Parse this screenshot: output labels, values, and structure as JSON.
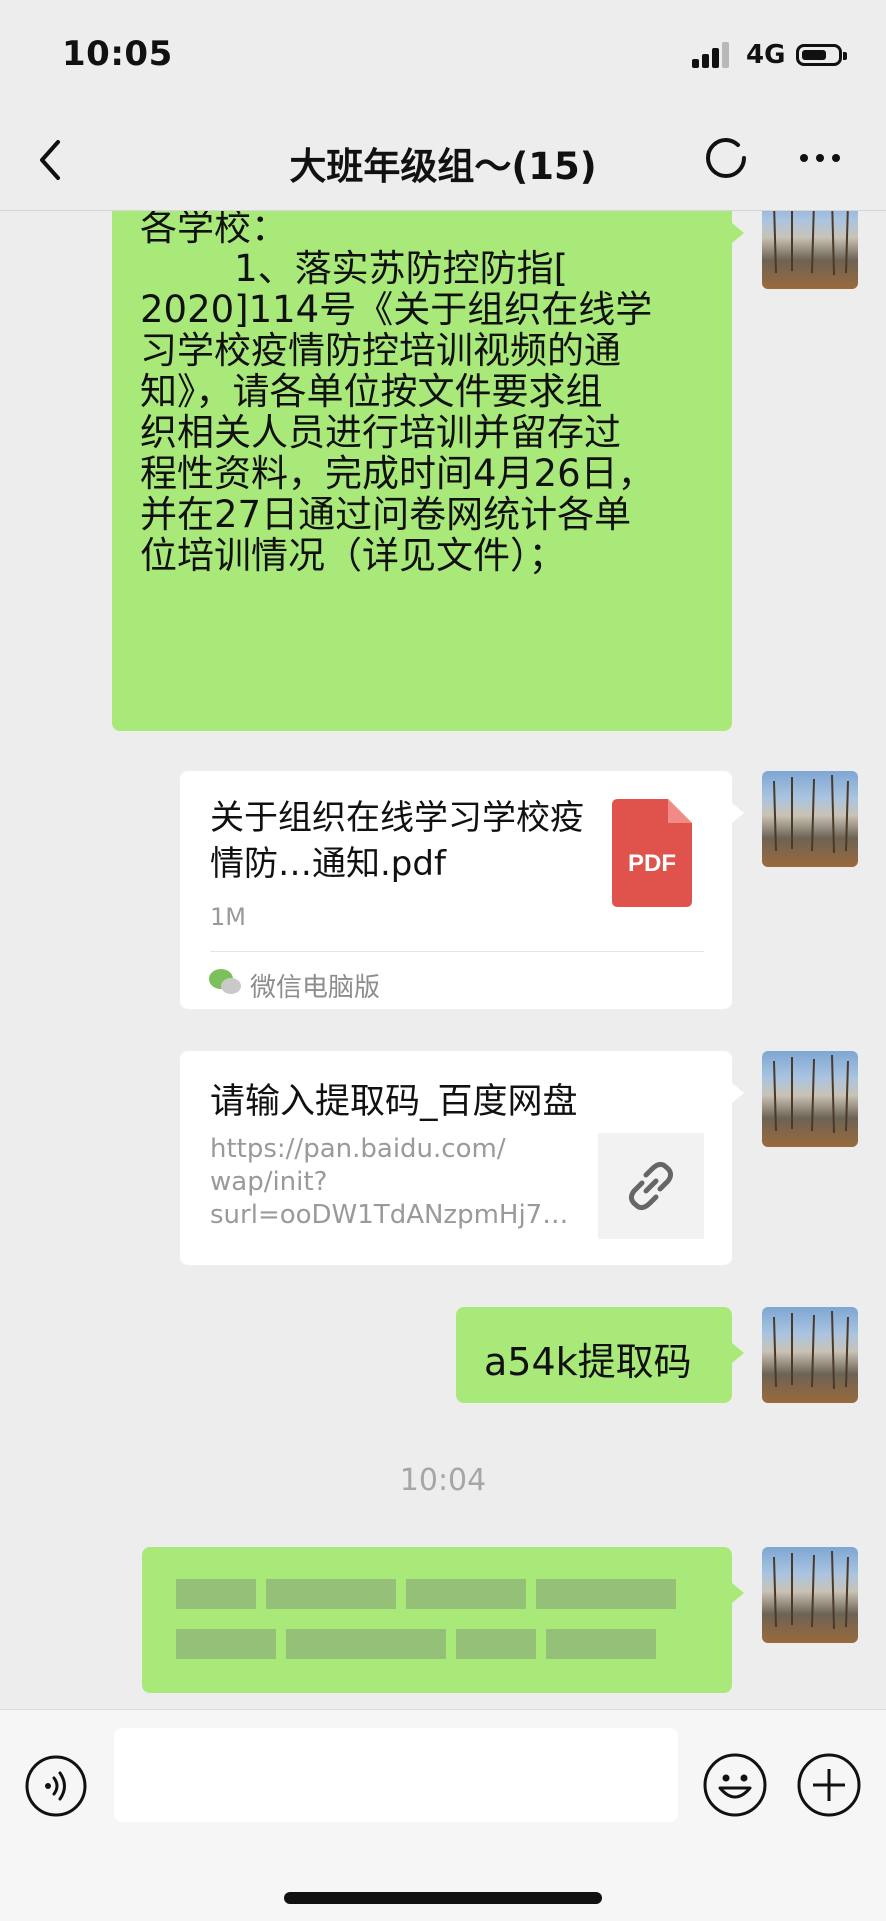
{
  "status_bar": {
    "time": "10:05",
    "network": "4G",
    "battery_level": 0.7
  },
  "header": {
    "title": "大班年级组～(15)"
  },
  "messages": [
    {
      "type": "text",
      "text": "各学校：\n        1、落实苏防控防指[\n2020]114号《关于组织在线学\n习学校疫情防控培训视频的通\n知》，请各单位按文件要求组\n织相关人员进行培训并留存过\n程性资料，完成时间4月26日，\n并在27日通过问卷网统计各单\n位培训情况（详见文件）；"
    },
    {
      "type": "file",
      "title": "关于组织在线学习学校疫情防…通知.pdf",
      "size": "1M",
      "icon_label": "PDF",
      "source": "微信电脑版"
    },
    {
      "type": "link",
      "title": "请输入提取码_百度网盘",
      "url": "https://pan.baidu.com/\nwap/init?\nsurl=ooDW1TdANzpmHj7…"
    },
    {
      "type": "text",
      "text": "a54k提取码"
    },
    {
      "type": "timestamp",
      "text": "10:04"
    },
    {
      "type": "text_blurred"
    }
  ],
  "colors": {
    "own_bubble": "#a9e97a",
    "background": "#ededed",
    "pdf_red": "#e0534c"
  }
}
